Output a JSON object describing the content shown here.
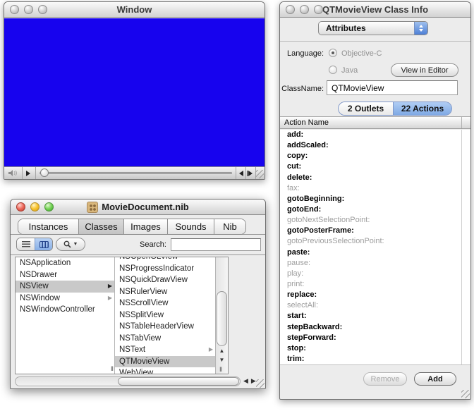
{
  "colors": {
    "movie_view_blue": "#1703ee",
    "selection_gray": "#c9c9c9",
    "tab_selected_blue": "#7fa9e4"
  },
  "icons": {
    "disclosure_arrow": "▶",
    "up_arrow": "▲",
    "down_arrow": "▼",
    "left_arrow": "◀",
    "right_arrow": "▶",
    "dropdown_arrow": "▼",
    "column_grip": "II"
  },
  "movie_window": {
    "title": "Window"
  },
  "nib_window": {
    "title": "MovieDocument.nib",
    "tabs": [
      {
        "label": "Instances",
        "selected": false
      },
      {
        "label": "Classes",
        "selected": true
      },
      {
        "label": "Images",
        "selected": false
      },
      {
        "label": "Sounds",
        "selected": false
      },
      {
        "label": "Nib",
        "selected": false
      }
    ],
    "toolbar": {
      "search_label": "Search:",
      "search_value": ""
    },
    "browser": {
      "left_column": [
        {
          "label": "NSApplication",
          "selected": false,
          "has_children": false
        },
        {
          "label": "NSDrawer",
          "selected": false,
          "has_children": false
        },
        {
          "label": "NSView",
          "selected": true,
          "has_children": true
        },
        {
          "label": "NSWindow",
          "selected": false,
          "has_children": true
        },
        {
          "label": "NSWindowController",
          "selected": false,
          "has_children": false
        }
      ],
      "right_column": [
        {
          "label": "NSOpenGLView",
          "selected": false,
          "has_children": false,
          "clipped": true
        },
        {
          "label": "NSProgressIndicator",
          "selected": false,
          "has_children": false
        },
        {
          "label": "NSQuickDrawView",
          "selected": false,
          "has_children": false
        },
        {
          "label": "NSRulerView",
          "selected": false,
          "has_children": false
        },
        {
          "label": "NSScrollView",
          "selected": false,
          "has_children": false
        },
        {
          "label": "NSSplitView",
          "selected": false,
          "has_children": false
        },
        {
          "label": "NSTableHeaderView",
          "selected": false,
          "has_children": false
        },
        {
          "label": "NSTabView",
          "selected": false,
          "has_children": false
        },
        {
          "label": "NSText",
          "selected": false,
          "has_children": true
        },
        {
          "label": "QTMovieView",
          "selected": true,
          "has_children": false
        },
        {
          "label": "WebView",
          "selected": false,
          "has_children": false
        }
      ]
    }
  },
  "class_info_window": {
    "title": "QTMovieView Class Info",
    "popup_value": "Attributes",
    "language_label": "Language:",
    "language_options": [
      {
        "label": "Objective-C",
        "selected": true
      },
      {
        "label": "Java",
        "selected": false
      }
    ],
    "view_in_editor_label": "View in Editor",
    "classname_label": "ClassName:",
    "classname_value": "QTMovieView",
    "tabs": {
      "outlets": "2 Outlets",
      "actions": "22 Actions",
      "selected": "22 Actions"
    },
    "table_header": "Action Name",
    "actions": [
      {
        "name": "add:",
        "dim": false
      },
      {
        "name": "addScaled:",
        "dim": false
      },
      {
        "name": "copy:",
        "dim": false
      },
      {
        "name": "cut:",
        "dim": false
      },
      {
        "name": "delete:",
        "dim": false
      },
      {
        "name": "fax:",
        "dim": true
      },
      {
        "name": "gotoBeginning:",
        "dim": false
      },
      {
        "name": "gotoEnd:",
        "dim": false
      },
      {
        "name": "gotoNextSelectionPoint:",
        "dim": true
      },
      {
        "name": "gotoPosterFrame:",
        "dim": false
      },
      {
        "name": "gotoPreviousSelectionPoint:",
        "dim": true
      },
      {
        "name": "paste:",
        "dim": false
      },
      {
        "name": "pause:",
        "dim": true
      },
      {
        "name": "play:",
        "dim": true
      },
      {
        "name": "print:",
        "dim": true
      },
      {
        "name": "replace:",
        "dim": false
      },
      {
        "name": "selectAll:",
        "dim": true
      },
      {
        "name": "start:",
        "dim": false
      },
      {
        "name": "stepBackward:",
        "dim": false
      },
      {
        "name": "stepForward:",
        "dim": false
      },
      {
        "name": "stop:",
        "dim": false
      },
      {
        "name": "trim:",
        "dim": false
      }
    ],
    "remove_label": "Remove",
    "add_label": "Add"
  }
}
